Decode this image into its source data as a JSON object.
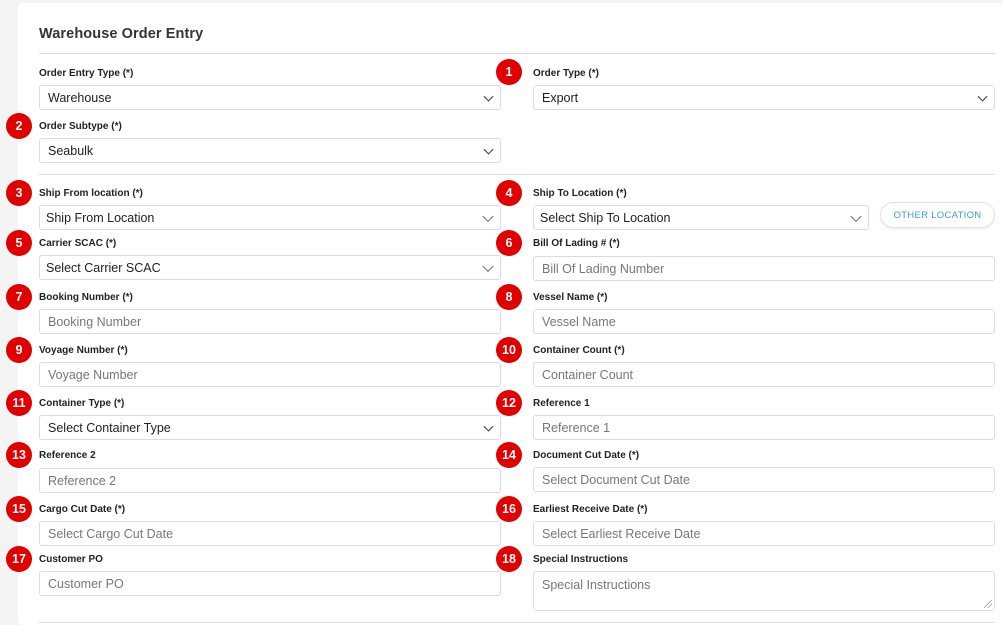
{
  "form": {
    "title": "Warehouse Order Entry",
    "fields": {
      "order_entry_type": {
        "label": "Order Entry Type (*)",
        "value": "Warehouse"
      },
      "order_type": {
        "label": "Order Type (*)",
        "value": "Export",
        "badge": "1"
      },
      "order_subtype": {
        "label": "Order Subtype (*)",
        "value": "Seabulk",
        "badge": "2"
      },
      "ship_from": {
        "label": "Ship From location (*)",
        "value": "Ship From Location",
        "badge": "3"
      },
      "ship_to": {
        "label": "Ship To Location (*)",
        "value": "Select Ship To Location",
        "badge": "4"
      },
      "carrier_scac": {
        "label": "Carrier SCAC (*)",
        "value": "Select Carrier SCAC",
        "badge": "5"
      },
      "bill_of_lading": {
        "label": "Bill Of Lading # (*)",
        "placeholder": "Bill Of Lading Number",
        "badge": "6"
      },
      "booking_number": {
        "label": "Booking Number (*)",
        "placeholder": "Booking Number",
        "badge": "7"
      },
      "vessel_name": {
        "label": "Vessel Name (*)",
        "placeholder": "Vessel Name",
        "badge": "8"
      },
      "voyage_number": {
        "label": "Voyage Number (*)",
        "placeholder": "Voyage Number",
        "badge": "9"
      },
      "container_count": {
        "label": "Container Count (*)",
        "placeholder": "Container Count",
        "badge": "10"
      },
      "container_type": {
        "label": "Container Type (*)",
        "value": "Select Container Type",
        "badge": "11"
      },
      "reference_1": {
        "label": "Reference 1",
        "placeholder": "Reference 1",
        "badge": "12"
      },
      "reference_2": {
        "label": "Reference 2",
        "placeholder": "Reference 2",
        "badge": "13"
      },
      "document_cut_date": {
        "label": "Document Cut Date (*)",
        "placeholder": "Select Document Cut Date",
        "badge": "14"
      },
      "cargo_cut_date": {
        "label": "Cargo Cut Date (*)",
        "placeholder": "Select Cargo Cut Date",
        "badge": "15"
      },
      "earliest_receive_date": {
        "label": "Earliest Receive Date (*)",
        "placeholder": "Select Earliest Receive Date",
        "badge": "16"
      },
      "customer_po": {
        "label": "Customer PO",
        "placeholder": "Customer PO",
        "badge": "17"
      },
      "special_instructions": {
        "label": "Special Instructions",
        "placeholder": "Special Instructions",
        "badge": "18"
      }
    },
    "other_location_button": "OTHER LOCATION"
  },
  "colors": {
    "badge": "#e00000",
    "accent": "#3aa2c6"
  }
}
